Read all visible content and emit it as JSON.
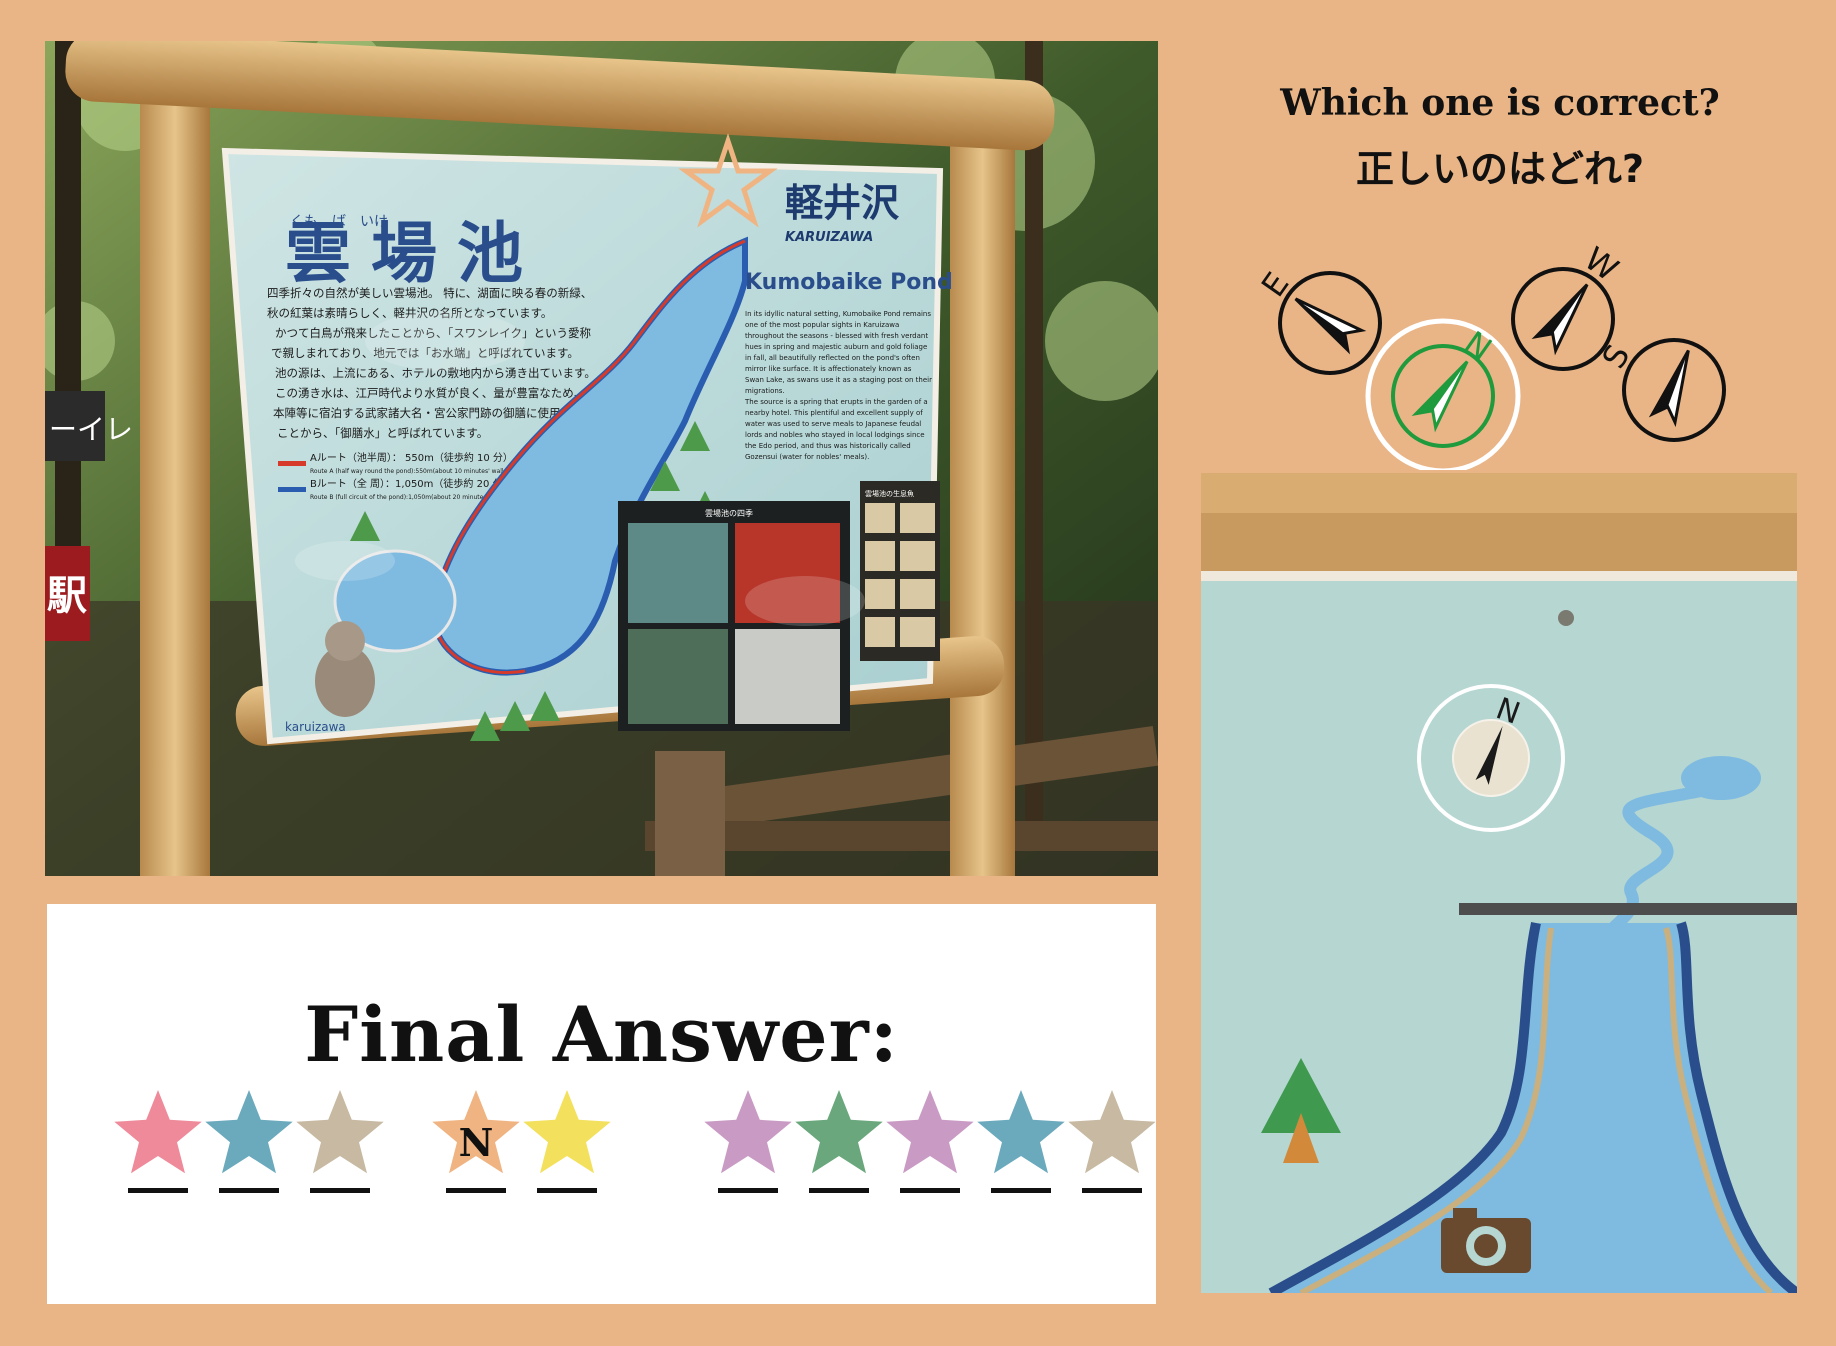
{
  "question": {
    "english": "Which one is correct?",
    "japanese": "正しいのはどれ?"
  },
  "compass_options": [
    {
      "letter": "E",
      "highlighted": false
    },
    {
      "letter": "N",
      "highlighted": true
    },
    {
      "letter": "W",
      "highlighted": false
    },
    {
      "letter": "S",
      "highlighted": false
    }
  ],
  "sign": {
    "title_jp": "雲場池",
    "title_ruby": "くも　ば　いけ",
    "brand_jp": "軽井沢",
    "brand_en": "KARUIZAWA",
    "pond_name_en": "Kumobaike Pond",
    "text_jp": [
      "四季折々の自然が美しい雲場池。 特に、湖面に映る春の新緑、",
      "秋の紅葉は素晴らしく、軽井沢の名所となっています。",
      "かつて白鳥が飛来したことから、「スワンレイク」という愛称",
      "で親しまれており、地元では「お水端」と呼ばれています。",
      "池の源は、上流にある、ホテルの敷地内から湧き出ています。",
      "この湧き水は、江戸時代より水質が良く、量が豊富なため、",
      "本陣等に宿泊する武家諸大名・宮公家門跡の御膳に使用された",
      "ことから、「御膳水」と呼ばれています。"
    ],
    "route_a": "Aルート（池半周）： 550m（徒歩約 10 分）",
    "route_a_en": "Route A (half way round the pond):550m(about 10 minutes' walk)",
    "route_b": "Bルート（全 周）：1,050m（徒歩約 20 分）",
    "route_b_en": "Route B (full circuit of the pond):1,050m(about 20 minutes' walk)",
    "text_en": [
      "In its idyllic natural setting, Kumobaike Pond remains",
      "one of the most popular sights in Karuizawa",
      "throughout the seasons - blessed with fresh verdant",
      "hues in spring and majestic auburn and gold foliage",
      "in fall, all beautifully reflected on the pond's often",
      "mirror like surface. It is affectionately known as",
      "Swan Lake, as swans use it as a staging post on their",
      "migrations.",
      "The source is a spring that erupts in the garden of a",
      "nearby hotel. This plentiful and excellent supply of",
      "water was used to serve meals to Japanese feudal",
      "lords and nobles who stayed in local lodgings since",
      "the Edo period, and thus was historically called",
      "Gozensui (water for nobles' meals)."
    ],
    "seasons_title": "雲場池の四季",
    "fish_title": "雲場池の生息魚",
    "footer_brand": "karuizawa",
    "left_post_sign": "ーイレ",
    "left_red_sign": "駅"
  },
  "answer": {
    "title": "Final Answer:",
    "groups": [
      {
        "stars": [
          {
            "color": "#ee8a9a",
            "letter": ""
          },
          {
            "color": "#6ba9bd",
            "letter": ""
          },
          {
            "color": "#c7b9a2",
            "letter": ""
          }
        ]
      },
      {
        "stars": [
          {
            "color": "#f0b482",
            "letter": "N"
          },
          {
            "color": "#f3e05c",
            "letter": ""
          }
        ]
      },
      {
        "stars": [
          {
            "color": "#c99bc4",
            "letter": ""
          },
          {
            "color": "#6aa77c",
            "letter": ""
          },
          {
            "color": "#c99bc4",
            "letter": ""
          },
          {
            "color": "#6ba9bd",
            "letter": ""
          },
          {
            "color": "#c7b9a2",
            "letter": ""
          }
        ]
      }
    ]
  },
  "zoom": {
    "compass_letter": "N"
  },
  "colors": {
    "background": "#e9b486",
    "highlight_green": "#1f9a3c",
    "sign_blue": "#2a4e8c",
    "pond_blue": "#7fbbe0"
  }
}
